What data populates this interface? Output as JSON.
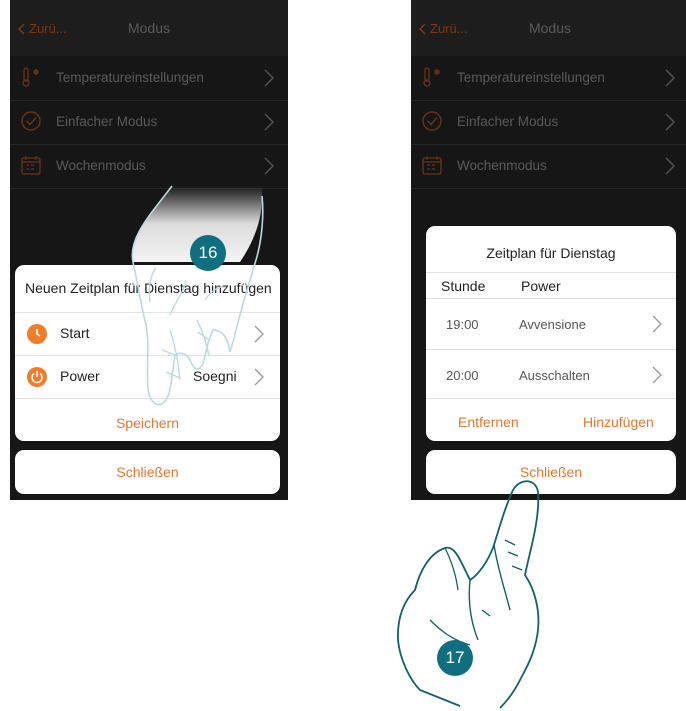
{
  "left_screen": {
    "nav": {
      "back_label": "Zurü...",
      "title": "Modus"
    },
    "menu": [
      {
        "label": "Temperatureinstellungen",
        "icon": "thermometer-icon"
      },
      {
        "label": "Einfacher Modus",
        "icon": "check-circle-icon"
      },
      {
        "label": "Wochenmodus",
        "icon": "calendar-icon"
      }
    ],
    "dialog": {
      "title": "Neuen Zeitplan für Dienstag hinzufügen",
      "rows": [
        {
          "label": "Start",
          "value": "",
          "icon": "clock-icon"
        },
        {
          "label": "Power",
          "value": "Soegni",
          "icon": "power-icon"
        }
      ],
      "save_label": "Speichern"
    },
    "close_label": "Schließen",
    "step_badge": "16"
  },
  "right_screen": {
    "nav": {
      "back_label": "Zurü...",
      "title": "Modus"
    },
    "menu": [
      {
        "label": "Temperatureinstellungen",
        "icon": "thermometer-icon"
      },
      {
        "label": "Einfacher Modus",
        "icon": "check-circle-icon"
      },
      {
        "label": "Wochenmodus",
        "icon": "calendar-icon"
      }
    ],
    "schedule": {
      "title": "Zeitplan für Dienstag",
      "columns": [
        "Stunde",
        "Power"
      ],
      "rows": [
        {
          "time": "19:00",
          "power": "Avvensione"
        },
        {
          "time": "20:00",
          "power": "Ausschalten"
        }
      ],
      "remove_label": "Entfernen",
      "add_label": "Hinzufügen"
    },
    "close_label": "Schließen",
    "step_badge": "17"
  },
  "colors": {
    "accent": "#e7762f",
    "badge": "#0f6f7e",
    "background": "#161616"
  }
}
